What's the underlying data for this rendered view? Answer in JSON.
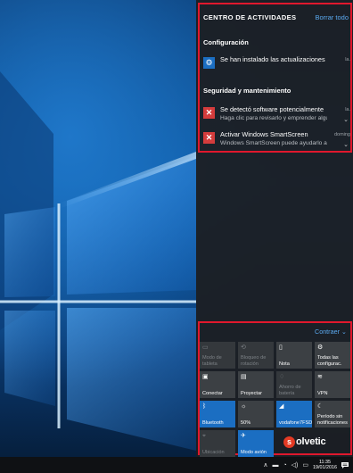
{
  "action_center": {
    "title": "CENTRO DE ACTIVIDADES",
    "clear_all": "Borrar todo",
    "groups": [
      {
        "name": "Configuración",
        "notifications": [
          {
            "title": "Se han instalado las actualizaciones",
            "body": "",
            "time": "la.",
            "icon": "gear-icon"
          }
        ]
      },
      {
        "name": "Seguridad y mantenimiento",
        "notifications": [
          {
            "title": "Se detectó software potencialmente",
            "body": "Haga clic para revisarlo y emprender algu",
            "time": "la.",
            "icon": "error-x-icon"
          },
          {
            "title": "Activar Windows SmartScreen",
            "body": "Windows SmartScreen puede ayudarlo a",
            "time": "doming",
            "icon": "error-x-icon"
          }
        ]
      }
    ]
  },
  "quick_actions": {
    "collapse_label": "Contraer",
    "tiles": [
      {
        "label": "Modo de tableta",
        "icon": "tablet-mode-icon",
        "state": "disabled"
      },
      {
        "label": "Bloqueo de rotación",
        "icon": "rotation-lock-icon",
        "state": "disabled"
      },
      {
        "label": "Nota",
        "icon": "note-icon",
        "state": "off"
      },
      {
        "label": "Todas las configurac.",
        "icon": "settings-icon",
        "state": "off"
      },
      {
        "label": "Conectar",
        "icon": "connect-icon",
        "state": "off"
      },
      {
        "label": "Proyectar",
        "icon": "project-icon",
        "state": "off"
      },
      {
        "label": "Ahorro de batería",
        "icon": "battery-saver-icon",
        "state": "disabled"
      },
      {
        "label": "VPN",
        "icon": "vpn-icon",
        "state": "off"
      },
      {
        "label": "Bluetooth",
        "icon": "bluetooth-icon",
        "state": "on"
      },
      {
        "label": "50%",
        "icon": "brightness-icon",
        "state": "off"
      },
      {
        "label": "vodafone7FSD",
        "icon": "wifi-icon",
        "state": "on"
      },
      {
        "label": "Período sin notificaciones",
        "icon": "quiet-hours-icon",
        "state": "off"
      },
      {
        "label": "Ubicación",
        "icon": "location-icon",
        "state": "disabled"
      },
      {
        "label": "Modo avión",
        "icon": "airplane-icon",
        "state": "on"
      }
    ]
  },
  "watermark": {
    "letter": "s",
    "text": "olvetic"
  },
  "taskbar": {
    "time": "11:35",
    "date": "19/01/2016",
    "tray_icons": [
      "chevron-up-icon",
      "network-icon",
      "wifi-icon",
      "volume-icon",
      "language-icon"
    ]
  },
  "colors": {
    "accent": "#1b6ec2",
    "link": "#5aa9ef",
    "highlight_border": "#e0182d",
    "panel_bg": "#1c1f23"
  }
}
